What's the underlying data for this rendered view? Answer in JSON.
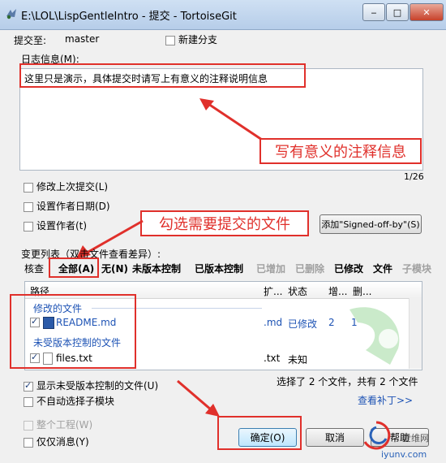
{
  "window": {
    "title": "E:\\LOL\\LispGentleIntro - 提交 - TortoiseGit",
    "minimize": "‒",
    "maximize": "□",
    "close": "✕"
  },
  "commit_to": {
    "label": "提交至:",
    "branch": "master"
  },
  "new_branch": {
    "label": "新建分支",
    "checked": false
  },
  "log_message": {
    "label": "日志信息(M):",
    "text": "这里只是演示，具体提交时请写上有意义的注释说明信息",
    "counter": "1/26"
  },
  "options": {
    "amend": "修改上次提交(L)",
    "set_date": "设置作者日期(D)",
    "set_author": "设置作者(t)",
    "signed_off_button": "添加\"Signed-off-by\"(S)"
  },
  "annotations": {
    "write_message": "写有意义的注释信息",
    "select_files": "勾选需要提交的文件"
  },
  "changes": {
    "label": "变更列表（双击文件查看差异）:",
    "filters": [
      {
        "label": "核查",
        "style": "normal"
      },
      {
        "label": "全部(A)",
        "style": "bold"
      },
      {
        "label": "无(N)",
        "style": "bold"
      },
      {
        "label": "未版本控制",
        "style": "bold"
      },
      {
        "label": "已版本控制",
        "style": "bold"
      },
      {
        "label": "已增加",
        "style": "dim"
      },
      {
        "label": "已删除",
        "style": "dim"
      },
      {
        "label": "已修改",
        "style": "bold"
      },
      {
        "label": "文件",
        "style": "bold"
      },
      {
        "label": "子模块",
        "style": "dim"
      }
    ],
    "columns": {
      "path": "路径",
      "ext": "扩...",
      "status": "状态",
      "add": "增...",
      "del": "删..."
    },
    "groups": [
      {
        "title": "修改的文件",
        "files": [
          {
            "name": "README.md",
            "ext": ".md",
            "status": "已修改",
            "add": "2",
            "del": "1",
            "checked": true
          }
        ]
      },
      {
        "title": "未受版本控制的文件",
        "files": [
          {
            "name": "files.txt",
            "ext": ".txt",
            "status": "未知",
            "add": "",
            "del": "",
            "checked": true
          }
        ]
      }
    ],
    "summary": "选择了 2 个文件，共有 2 个文件",
    "view_patch": "查看补丁>>"
  },
  "bottom": {
    "show_unversioned": "显示未受版本控制的文件(U)",
    "no_auto_submodule": "不自动选择子模块",
    "whole_project": "整个工程(W)",
    "message_only": "仅仅消息(Y)",
    "ok": "确定(O)",
    "cancel": "取消",
    "help": "帮助"
  },
  "watermark": {
    "line1": "爱维网",
    "line2": "iyunv.com"
  },
  "colors": {
    "accent_red": "#e0302b",
    "link_blue": "#1c52b4",
    "titlebar": "#c4d7ee"
  }
}
